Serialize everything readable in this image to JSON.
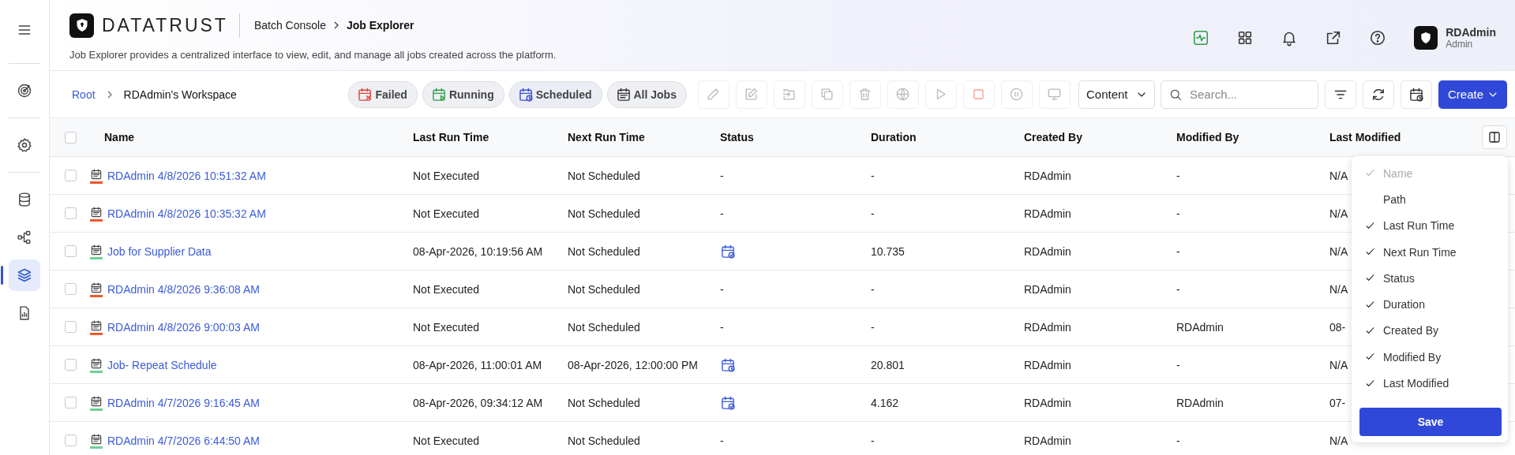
{
  "sidebar": {
    "items": [
      {
        "kind": "menu",
        "selected": false
      },
      {
        "kind": "target",
        "selected": false
      },
      {
        "kind": "settings",
        "selected": false
      },
      {
        "kind": "database",
        "selected": false
      },
      {
        "kind": "flow",
        "selected": false
      },
      {
        "kind": "layers",
        "selected": true
      },
      {
        "kind": "report",
        "selected": false
      }
    ]
  },
  "header": {
    "logo": "DATATRUST",
    "breadcrumb": [
      {
        "label": "Batch Console",
        "current": false
      },
      {
        "label": "Job Explorer",
        "current": true
      }
    ],
    "description": "Job Explorer provides a centralized interface to view, edit, and manage all jobs created across the platform.",
    "icons": [
      {
        "kind": "activity"
      },
      {
        "kind": "apps"
      },
      {
        "kind": "bell"
      },
      {
        "kind": "external"
      },
      {
        "kind": "help"
      }
    ],
    "user": {
      "name": "RDAdmin",
      "role": "Admin"
    }
  },
  "toolbar": {
    "path": [
      "Root",
      "RDAdmin's Workspace"
    ],
    "filters": [
      {
        "label": "Failed",
        "kind": "failed"
      },
      {
        "label": "Running",
        "kind": "running"
      },
      {
        "label": "Scheduled",
        "kind": "scheduled"
      },
      {
        "label": "All Jobs",
        "kind": "all"
      }
    ],
    "actions": [
      {
        "kind": "pencil",
        "disabled": true
      },
      {
        "kind": "edit",
        "disabled": true
      },
      {
        "kind": "move",
        "disabled": true
      },
      {
        "kind": "copy",
        "disabled": true
      },
      {
        "kind": "trash",
        "disabled": true
      },
      {
        "kind": "globe",
        "disabled": true
      },
      {
        "kind": "play",
        "disabled": true
      },
      {
        "kind": "stop",
        "disabled": true
      },
      {
        "kind": "pause",
        "disabled": true
      },
      {
        "kind": "monitor",
        "disabled": true
      }
    ],
    "content_select": "Content",
    "search": {
      "placeholder": "Search..."
    },
    "right_actions": [
      {
        "kind": "filter"
      },
      {
        "kind": "refresh"
      },
      {
        "kind": "calendar"
      }
    ],
    "create": "Create"
  },
  "table": {
    "select_all": {
      "checked": false
    },
    "columns": [
      "Name",
      "Last Run Time",
      "Next Run Time",
      "Status",
      "Duration",
      "Created By",
      "Modified By",
      "Last Modified"
    ],
    "rows": [
      {
        "checked": false,
        "color": "#f0582a",
        "name": "RDAdmin 4/8/2026 10:51:32 AM",
        "last_run": "Not Executed",
        "next_run": "Not Scheduled",
        "status": {
          "kind": "text",
          "text": "-"
        },
        "duration": "-",
        "created_by": "RDAdmin",
        "modified_by": "-",
        "last_modified": "N/A"
      },
      {
        "checked": false,
        "color": "#f0582a",
        "name": "RDAdmin 4/8/2026 10:35:32 AM",
        "last_run": "Not Executed",
        "next_run": "Not Scheduled",
        "status": {
          "kind": "text",
          "text": "-"
        },
        "duration": "-",
        "created_by": "RDAdmin",
        "modified_by": "-",
        "last_modified": "N/A"
      },
      {
        "checked": false,
        "color": "#6fcf97",
        "name": "Job for Supplier Data",
        "last_run": "08-Apr-2026, 10:19:56 AM",
        "next_run": "Not Scheduled",
        "status": {
          "kind": "calendar-check"
        },
        "duration": "10.735",
        "created_by": "RDAdmin",
        "modified_by": "-",
        "last_modified": "N/A"
      },
      {
        "checked": false,
        "color": "#f0582a",
        "name": "RDAdmin 4/8/2026 9:36:08 AM",
        "last_run": "Not Executed",
        "next_run": "Not Scheduled",
        "status": {
          "kind": "text",
          "text": "-"
        },
        "duration": "-",
        "created_by": "RDAdmin",
        "modified_by": "-",
        "last_modified": "N/A"
      },
      {
        "checked": false,
        "color": "#f0582a",
        "name": "RDAdmin 4/8/2026 9:00:03 AM",
        "last_run": "Not Executed",
        "next_run": "Not Scheduled",
        "status": {
          "kind": "text",
          "text": "-"
        },
        "duration": "-",
        "created_by": "RDAdmin",
        "modified_by": "RDAdmin",
        "last_modified": "08-"
      },
      {
        "checked": false,
        "color": "#6fcf97",
        "name": "Job- Repeat Schedule",
        "last_run": "08-Apr-2026, 11:00:01 AM",
        "next_run": "08-Apr-2026, 12:00:00 PM",
        "status": {
          "kind": "calendar-clock"
        },
        "duration": "20.801",
        "created_by": "RDAdmin",
        "modified_by": "-",
        "last_modified": "N/A"
      },
      {
        "checked": false,
        "color": "#6fcf97",
        "name": "RDAdmin 4/7/2026 9:16:45 AM",
        "last_run": "08-Apr-2026, 09:34:12 AM",
        "next_run": "Not Scheduled",
        "status": {
          "kind": "calendar-check"
        },
        "duration": "4.162",
        "created_by": "RDAdmin",
        "modified_by": "RDAdmin",
        "last_modified": "07-"
      },
      {
        "checked": false,
        "color": "#6fcf97",
        "name": "RDAdmin 4/7/2026 6:44:50 AM",
        "last_run": "Not Executed",
        "next_run": "Not Scheduled",
        "status": {
          "kind": "text",
          "text": "-"
        },
        "duration": "-",
        "created_by": "RDAdmin",
        "modified_by": "-",
        "last_modified": "N/A"
      }
    ]
  },
  "column_menu": {
    "items": [
      {
        "label": "Name",
        "checked": true,
        "disabled": true
      },
      {
        "label": "Path",
        "checked": false,
        "disabled": false
      },
      {
        "label": "Last Run Time",
        "checked": true,
        "disabled": false
      },
      {
        "label": "Next Run Time",
        "checked": true,
        "disabled": false
      },
      {
        "label": "Status",
        "checked": true,
        "disabled": false
      },
      {
        "label": "Duration",
        "checked": true,
        "disabled": false
      },
      {
        "label": "Created By",
        "checked": true,
        "disabled": false
      },
      {
        "label": "Modified By",
        "checked": true,
        "disabled": false
      },
      {
        "label": "Last Modified",
        "checked": true,
        "disabled": false
      }
    ],
    "save": "Save"
  }
}
